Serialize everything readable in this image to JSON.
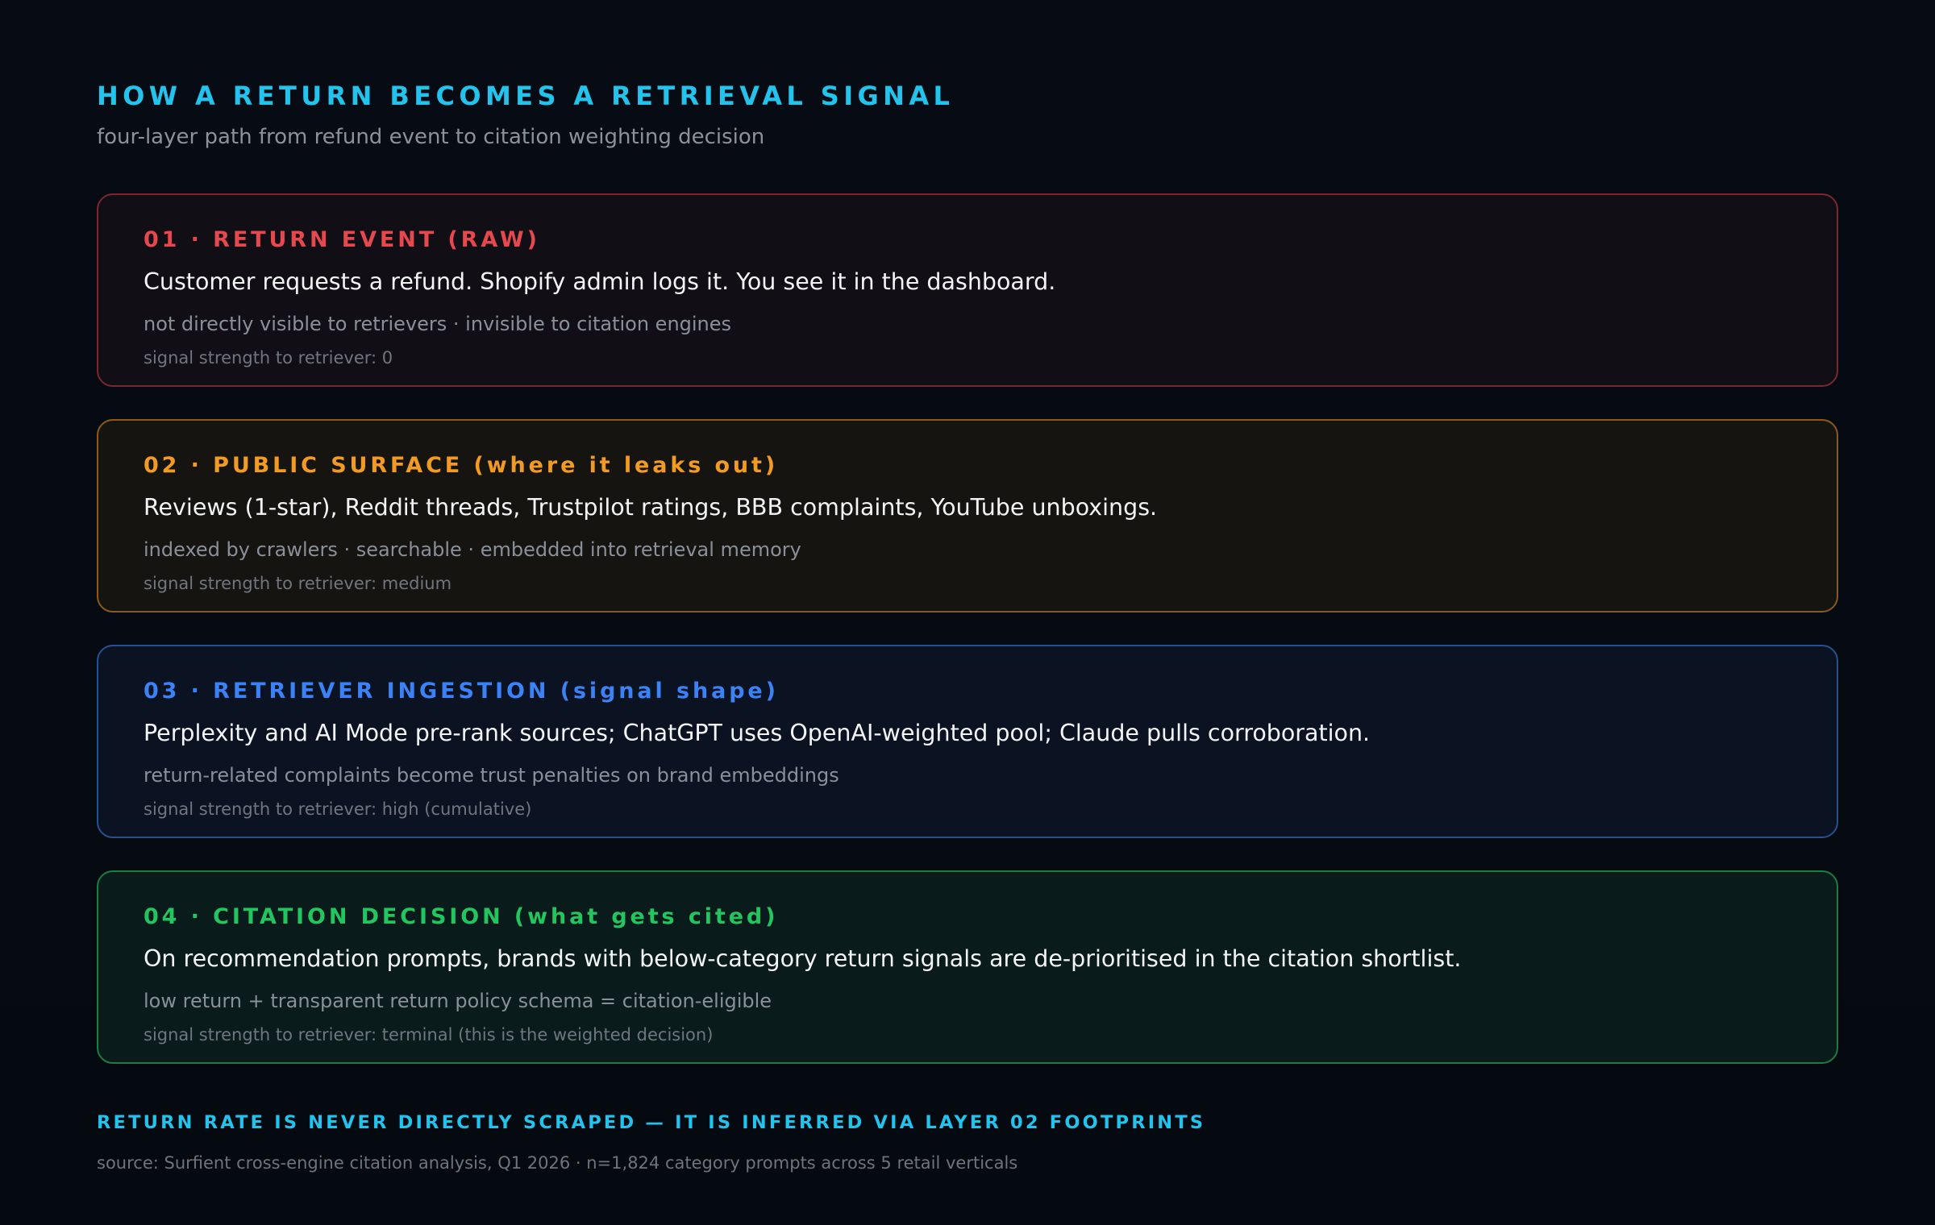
{
  "header": {
    "title": "HOW A RETURN BECOMES A RETRIEVAL SIGNAL",
    "subtitle": "four-layer path from refund event to citation weighting decision"
  },
  "layers": [
    {
      "heading": "01 · RETURN EVENT (RAW)",
      "description": "Customer requests a refund. Shopify admin logs it. You see it in the dashboard.",
      "note": "not directly visible to retrievers · invisible to citation engines",
      "signal": "signal strength to retriever: 0",
      "accent_color": "#e5484d",
      "border_color": "#7a2730",
      "background_color": "#120e16"
    },
    {
      "heading": "02 · PUBLIC SURFACE (where it leaks out)",
      "description": "Reviews (1-star), Reddit threads, Trustpilot ratings, BBB complaints, YouTube unboxings.",
      "note": "indexed by crawlers · searchable · embedded into retrieval memory",
      "signal": "signal strength to retriever: medium",
      "accent_color": "#f29b24",
      "border_color": "#8a5a1c",
      "background_color": "#161411"
    },
    {
      "heading": "03 · RETRIEVER INGESTION (signal shape)",
      "description": "Perplexity and AI Mode pre-rank sources; ChatGPT uses OpenAI-weighted pool; Claude pulls corroboration.",
      "note": "return-related complaints become trust penalties on brand embeddings",
      "signal": "signal strength to retriever: high (cumulative)",
      "accent_color": "#3b82f6",
      "border_color": "#2a4f8e",
      "background_color": "#0b1322"
    },
    {
      "heading": "04 · CITATION DECISION (what gets cited)",
      "description": "On recommendation prompts, brands with below-category return signals are de-prioritised in the citation shortlist.",
      "note": "low return + transparent return policy schema = citation-eligible",
      "signal": "signal strength to retriever: terminal (this is the weighted decision)",
      "accent_color": "#22c55e",
      "border_color": "#1f7a44",
      "background_color": "#0a1b1c"
    }
  ],
  "footer": {
    "callout": "RETURN RATE IS NEVER DIRECTLY SCRAPED — IT IS INFERRED VIA LAYER 02 FOOTPRINTS",
    "source": "source: Surfient cross-engine citation analysis, Q1 2026 · n=1,824 category prompts across 5 retail verticals"
  },
  "colors": {
    "page_background": "#060a12",
    "title_accent": "#22c3ec",
    "body_text": "#f3f4f6",
    "muted_text": "#8a909a"
  }
}
